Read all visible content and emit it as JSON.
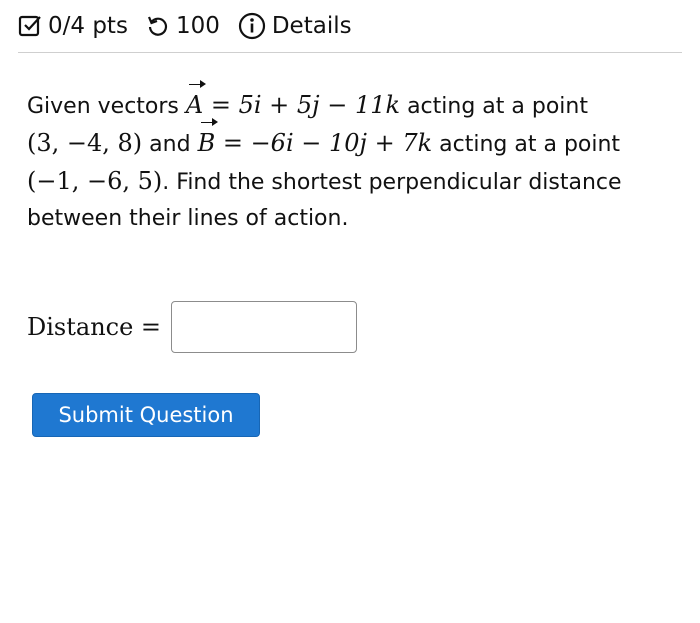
{
  "header": {
    "score": "0/4 pts",
    "attempts": "100",
    "details": "Details",
    "icons": [
      "checkbox-icon",
      "retry-icon",
      "info-icon"
    ]
  },
  "question": {
    "line1_prefix": "Given vectors ",
    "vecA_name": "A",
    "vecA_value": " = 5i + 5j − 11k",
    "line1_suffix": " acting at a point",
    "pointA": "(3, −4, 8)",
    "and_text": " and ",
    "vecB_name": "B",
    "vecB_value": " = −6i − 10j + 7k",
    "line2_suffix": " acting at a point",
    "pointB": "(−1, −6, 5)",
    "line3_suffix": ". Find the shortest perpendicular distance",
    "line4": "between their lines of action."
  },
  "answer": {
    "label": "Distance =",
    "value": ""
  },
  "submit_label": "Submit Question",
  "colors": {
    "submit_bg": "#1f78d1",
    "header_rule": "#cfcfcf"
  }
}
